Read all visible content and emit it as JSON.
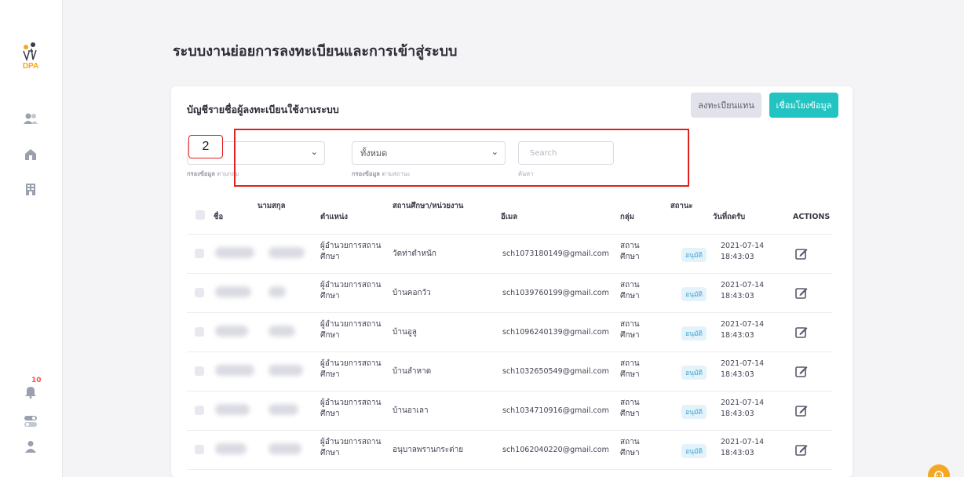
{
  "page": {
    "title": "ระบบงานย่อยการลงทะเบียนและการเข้าสู่ระบบ"
  },
  "brand": {
    "logo_text": "DPA",
    "accent": "#22c4c2"
  },
  "sidebar": {
    "icons": [
      "users-icon",
      "home-icon",
      "building-icon",
      "bell-icon",
      "toggle-icon",
      "user-icon"
    ],
    "notification_count": "10"
  },
  "card": {
    "title": "บัญชีรายชื่อผู้ลงทะเบียนใช้งานระบบ",
    "btn_register": "ลงทะเบียนแทน",
    "btn_link": "เชื่อมโยงข้อมูล"
  },
  "filters": {
    "group_value": "",
    "group_help_bold": "กรองข้อมูล",
    "group_help": "ตามกลุ่ม",
    "status_value": "ทั้งหมด",
    "status_help_bold": "กรองข้อมูล",
    "status_help": "ตามสถานะ",
    "search_placeholder": "Search",
    "search_help": "ค้นหา"
  },
  "annotation": {
    "callout": "2"
  },
  "table": {
    "columns": {
      "first_name": "ชื่อ",
      "last_name": "นามสกุล",
      "position": "ตำแหน่ง",
      "school": "สถานศึกษา/หน่วยงาน",
      "email": "อีเมล",
      "group": "กลุ่ม",
      "status": "สถานะ",
      "date": "วันที่ถดรับ",
      "actions": "ACTIONS"
    },
    "rows": [
      {
        "position": "ผู้อำนวยการสถานศึกษา",
        "school": "วัดท่าตำหนัก",
        "email": "sch1073180149@gmail.com",
        "group": "สถานศึกษา",
        "status": "อนุมัติ",
        "date": "2021-07-14 18:43:03"
      },
      {
        "position": "ผู้อำนวยการสถานศึกษา",
        "school": "บ้านคอกวัว",
        "email": "sch1039760199@gmail.com",
        "group": "สถานศึกษา",
        "status": "อนุมัติ",
        "date": "2021-07-14 18:43:03"
      },
      {
        "position": "ผู้อำนวยการสถานศึกษา",
        "school": "บ้านอูลู",
        "email": "sch1096240139@gmail.com",
        "group": "สถานศึกษา",
        "status": "อนุมัติ",
        "date": "2021-07-14 18:43:03"
      },
      {
        "position": "ผู้อำนวยการสถานศึกษา",
        "school": "บ้านลำหาด",
        "email": "sch1032650549@gmail.com",
        "group": "สถานศึกษา",
        "status": "อนุมัติ",
        "date": "2021-07-14 18:43:03"
      },
      {
        "position": "ผู้อำนวยการสถานศึกษา",
        "school": "บ้านอาเลา",
        "email": "sch1034710916@gmail.com",
        "group": "สถานศึกษา",
        "status": "อนุมัติ",
        "date": "2021-07-14 18:43:03"
      },
      {
        "position": "ผู้อำนวยการสถานศึกษา",
        "school": "อนุบาลพรานกระต่าย",
        "email": "sch1062040220@gmail.com",
        "group": "สถานศึกษา",
        "status": "อนุมัติ",
        "date": "2021-07-14 18:43:03"
      }
    ]
  }
}
